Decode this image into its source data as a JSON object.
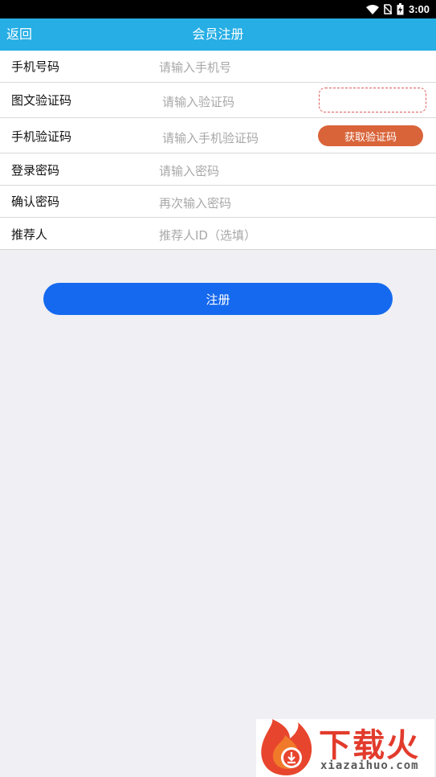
{
  "status_bar": {
    "time": "3:00",
    "icons": [
      "wifi-icon",
      "no-sim-icon",
      "battery-icon"
    ]
  },
  "header": {
    "back_label": "返回",
    "title": "会员注册",
    "background_color": "#26aee5"
  },
  "form": {
    "phone": {
      "label": "手机号码",
      "placeholder": "请输入手机号"
    },
    "image_captcha": {
      "label": "图文验证码",
      "placeholder": "请输入验证码"
    },
    "sms_code": {
      "label": "手机验证码",
      "placeholder": "请输入手机验证码",
      "button_label": "获取验证码",
      "button_color": "#d9643a"
    },
    "password": {
      "label": "登录密码",
      "placeholder": "请输入密码"
    },
    "confirm_password": {
      "label": "确认密码",
      "placeholder": "再次输入密码"
    },
    "referrer": {
      "label": "推荐人",
      "placeholder": "推荐人ID（选填）"
    }
  },
  "register_button": {
    "label": "注册",
    "color": "#1569ef"
  },
  "watermark": {
    "brand": "下载火",
    "url": "xiazaihuo.com",
    "color": "#e23b2c"
  }
}
